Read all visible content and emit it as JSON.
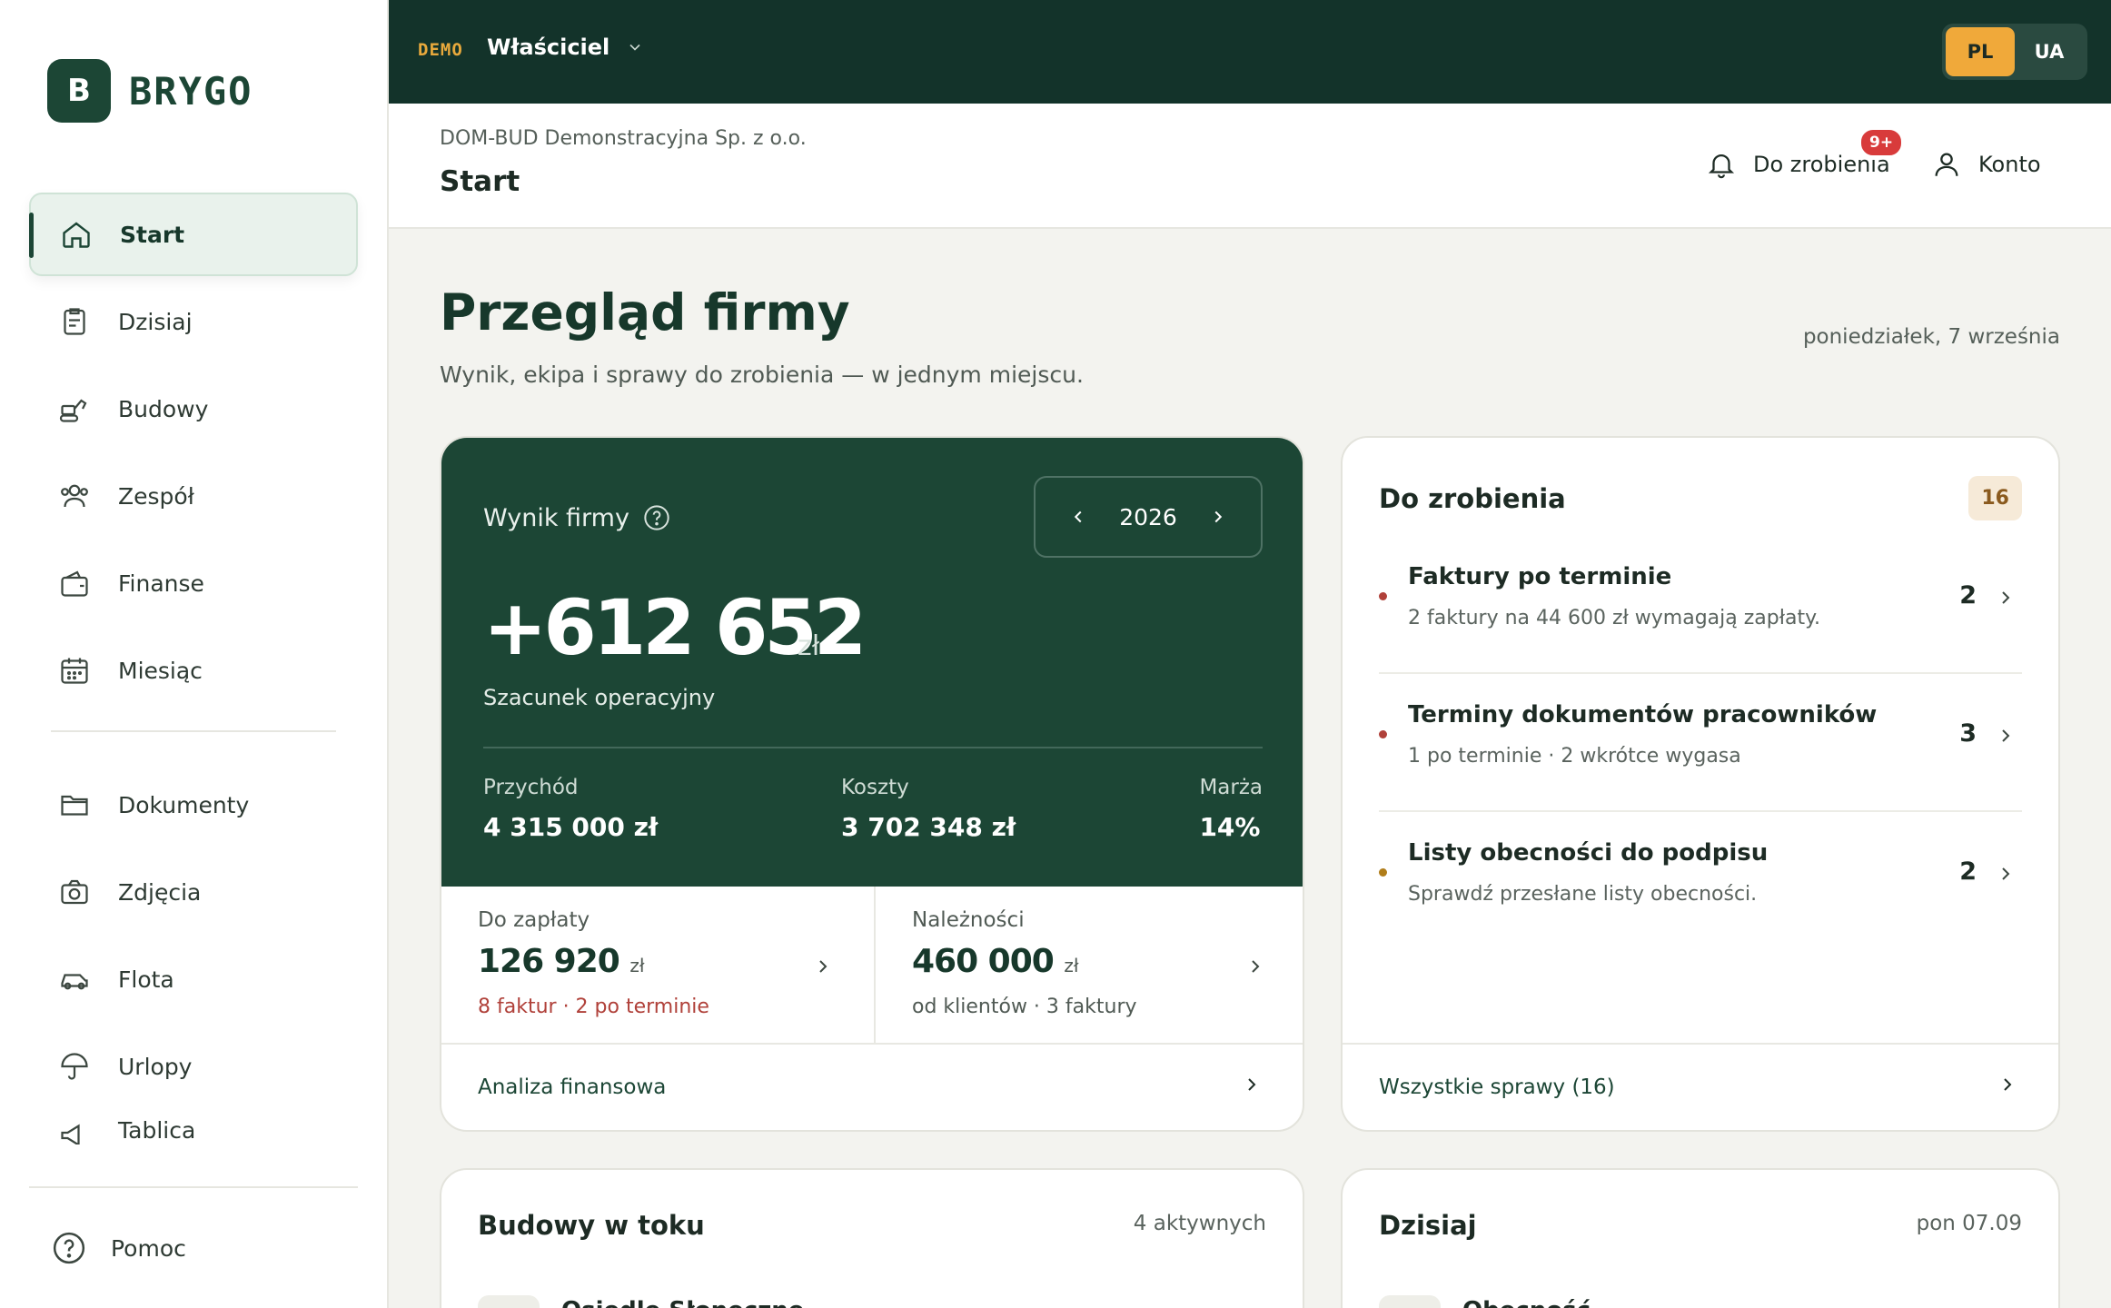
{
  "logo": {
    "mark": "B",
    "name": "BRYGO"
  },
  "sidebar": {
    "items": [
      {
        "label": "Start",
        "icon": "home-icon"
      },
      {
        "label": "Dzisiaj",
        "icon": "clipboard-icon"
      },
      {
        "label": "Budowy",
        "icon": "excavator-icon"
      },
      {
        "label": "Zespół",
        "icon": "users-icon"
      },
      {
        "label": "Finanse",
        "icon": "wallet-icon"
      },
      {
        "label": "Miesiąc",
        "icon": "calendar-icon"
      }
    ],
    "items2": [
      {
        "label": "Dokumenty",
        "icon": "folder-icon"
      },
      {
        "label": "Zdjęcia",
        "icon": "camera-icon"
      },
      {
        "label": "Flota",
        "icon": "car-icon"
      },
      {
        "label": "Urlopy",
        "icon": "umbrella-icon"
      },
      {
        "label": "Tablica",
        "icon": "megaphone-icon"
      }
    ],
    "help": "Pomoc"
  },
  "topbar": {
    "demo": "DEMO",
    "role": "Właściciel",
    "lang_pl": "PL",
    "lang_ua": "UA"
  },
  "header": {
    "company": "DOM-BUD Demonstracyjna Sp. z o.o.",
    "title": "Start",
    "todo_label": "Do zrobienia",
    "todo_badge": "9+",
    "account_label": "Konto"
  },
  "main": {
    "title": "Przegląd firmy",
    "subtitle": "Wynik, ekipa i sprawy do zrobienia — w jednym miejscu.",
    "date": "poniedziałek, 7 września"
  },
  "finance": {
    "label": "Wynik firmy",
    "year": "2026",
    "value": "+612 652",
    "unit": "zł",
    "value_sub": "Szacunek operacyjny",
    "revenue_label": "Przychód",
    "revenue": "4 315 000 zł",
    "costs_label": "Koszty",
    "costs": "3 702 348 zł",
    "margin_label": "Marża",
    "margin": "14%",
    "payable_label": "Do zapłaty",
    "payable": "126 920",
    "payable_unit": "zł",
    "payable_sub": "8 faktur · 2 po terminie",
    "receivable_label": "Należności",
    "receivable": "460 000",
    "receivable_unit": "zł",
    "receivable_sub": "od klientów · 3 faktury",
    "link": "Analiza finansowa"
  },
  "todo": {
    "title": "Do zrobienia",
    "count": "16",
    "items": [
      {
        "name": "Faktury po terminie",
        "desc": "2 faktury na 44 600 zł wymagają zapłaty.",
        "count": "2"
      },
      {
        "name": "Terminy dokumentów pracowników",
        "desc": "1 po terminie · 2 wkrótce wygasa",
        "count": "3"
      },
      {
        "name": "Listy obecności do podpisu",
        "desc": "Sprawdź przesłane listy obecności.",
        "count": "2"
      }
    ],
    "link": "Wszystkie sprawy (16)"
  },
  "builds": {
    "title": "Budowy w toku",
    "meta": "4 aktywnych",
    "first": "Osiedle Słoneczne"
  },
  "today": {
    "title": "Dzisiaj",
    "meta": "pon 07.09",
    "first": "Obecność"
  }
}
